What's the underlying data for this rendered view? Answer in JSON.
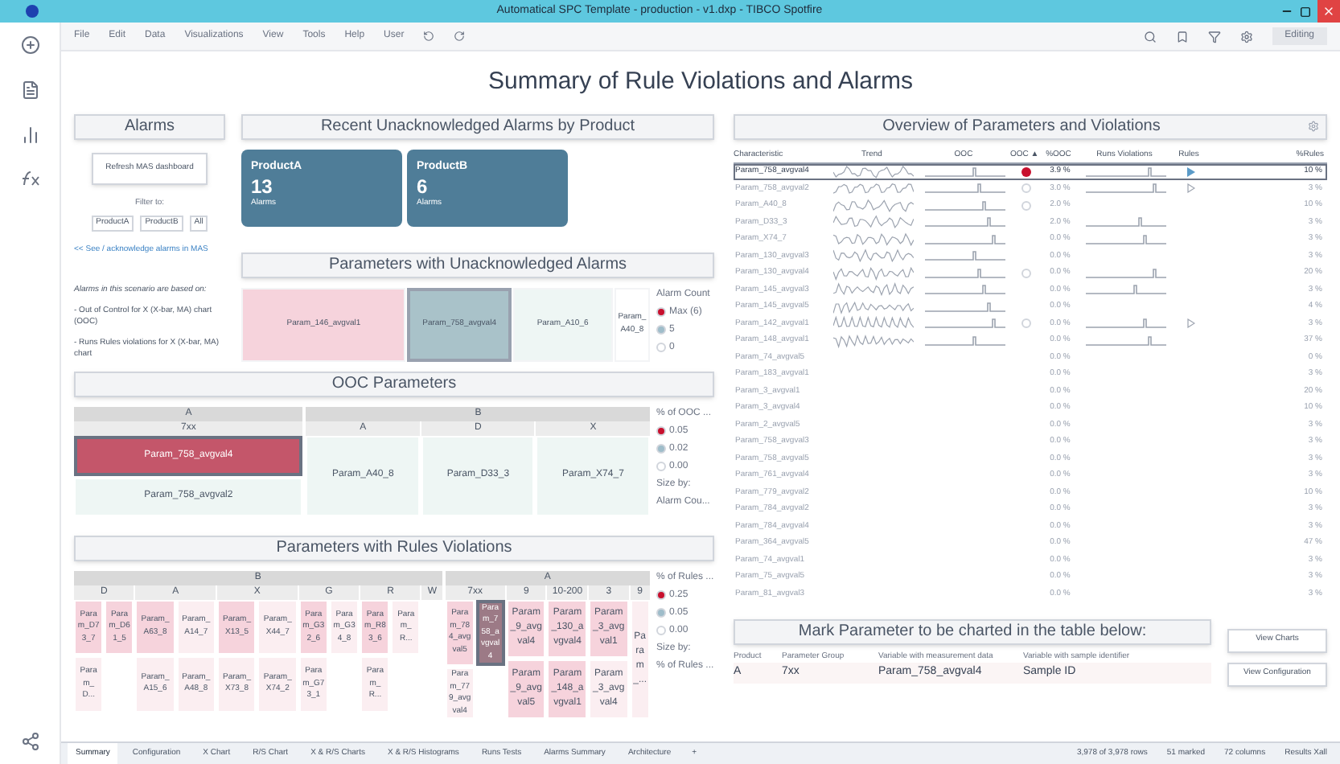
{
  "window": {
    "title": "Automatical SPC Template - production - v1.dxp - TIBCO Spotfire"
  },
  "menu": [
    "File",
    "Edit",
    "Data",
    "Visualizations",
    "View",
    "Tools",
    "Help",
    "User"
  ],
  "mode": "Editing",
  "page_title": "Summary of Rule Violations and Alarms",
  "alarms": {
    "header": "Alarms",
    "refresh": "Refresh MAS dashboard",
    "filter_label": "Filter to:",
    "filters": [
      "ProductA",
      "ProductB",
      "All"
    ],
    "link": "<< See / acknowledge alarms in MAS",
    "notes": [
      "Alarms in this scenario are based on:",
      "- Out of Control for X (X-bar, MA) chart (OOC)",
      "- Runs Rules violations for X (X-bar, MA) chart"
    ]
  },
  "recent": {
    "header": "Recent Unacknowledged Alarms by Product",
    "tiles": [
      {
        "product": "ProductA",
        "count": "13",
        "unit": "Alarms"
      },
      {
        "product": "ProductB",
        "count": "6",
        "unit": "Alarms"
      }
    ]
  },
  "unack": {
    "header": "Parameters with Unacknowledged Alarms",
    "cells": [
      {
        "name": "Param_146_avgval1",
        "color": "#f6d3dc",
        "selected": false
      },
      {
        "name": "Param_758_avgval4",
        "color": "#a9c2c9",
        "selected": true
      },
      {
        "name": "Param_A10_6",
        "color": "#eef6f4",
        "selected": false
      },
      {
        "name": "Param_A40_8",
        "color": "#ffffff",
        "selected": false
      }
    ],
    "legend": {
      "title": "Alarm Count",
      "items": [
        {
          "label": "Max (6)",
          "color": "#c8102e"
        },
        {
          "label": "5",
          "color": "#9fbdca"
        },
        {
          "label": "0",
          "color": "#ffffff"
        }
      ]
    }
  },
  "ooc": {
    "header": "OOC Parameters",
    "groups": [
      {
        "label": "A",
        "subgroups": [
          {
            "label": "7xx",
            "cells": [
              {
                "name": "Param_758_avgval4",
                "color": "#c4566a",
                "selected": true
              },
              {
                "name": "Param_758_avgval2",
                "color": "#eef6f4",
                "selected": false
              }
            ]
          }
        ]
      },
      {
        "label": "B",
        "subgroups": [
          {
            "label": "A",
            "cells": [
              {
                "name": "Param_A40_8",
                "color": "#eef6f4",
                "selected": false
              }
            ]
          },
          {
            "label": "D",
            "cells": [
              {
                "name": "Param_D33_3",
                "color": "#eef6f4",
                "selected": false
              }
            ]
          },
          {
            "label": "X",
            "cells": [
              {
                "name": "Param_X74_7",
                "color": "#eef6f4",
                "selected": false
              }
            ]
          }
        ]
      }
    ],
    "legend": {
      "title": "% of OOC ...",
      "items": [
        {
          "label": "0.05",
          "color": "#c8102e"
        },
        {
          "label": "0.02",
          "color": "#9fbdca"
        },
        {
          "label": "0.00",
          "color": "#ffffff"
        }
      ],
      "size_label": "Size by:",
      "size_value": "Alarm Cou..."
    }
  },
  "rules": {
    "header": "Parameters with Rules Violations",
    "groups": [
      {
        "label": "B",
        "subgroups": [
          {
            "label": "D",
            "cells": [
              {
                "name": "Param_D73_7",
                "color": "#f6d3dc",
                "selected": false
              },
              {
                "name": "Param_D61_5",
                "color": "#f6d3dc",
                "selected": false
              },
              {
                "name": "Param_D...",
                "color": "#fbeef1",
                "selected": false
              }
            ]
          },
          {
            "label": "A",
            "cells": [
              {
                "name": "Param_A63_8",
                "color": "#f6d3dc",
                "selected": false
              },
              {
                "name": "Param_A14_7",
                "color": "#fbeef1",
                "selected": false
              },
              {
                "name": "Param_A15_6",
                "color": "#fbeef1",
                "selected": false
              },
              {
                "name": "Param_A48_8",
                "color": "#fbeef1",
                "selected": false
              }
            ]
          },
          {
            "label": "X",
            "cells": [
              {
                "name": "Param_X13_5",
                "color": "#f6d3dc",
                "selected": false
              },
              {
                "name": "Param_X44_7",
                "color": "#fbeef1",
                "selected": false
              },
              {
                "name": "Param_X73_8",
                "color": "#fbeef1",
                "selected": false
              },
              {
                "name": "Param_X74_2",
                "color": "#fbeef1",
                "selected": false
              }
            ]
          },
          {
            "label": "G",
            "cells": [
              {
                "name": "Param_G32_6",
                "color": "#f6d3dc",
                "selected": false
              },
              {
                "name": "Param_G34_8",
                "color": "#fbeef1",
                "selected": false
              },
              {
                "name": "Param_G73_1",
                "color": "#fbeef1",
                "selected": false
              }
            ]
          },
          {
            "label": "R",
            "cells": [
              {
                "name": "Param_R83_6",
                "color": "#f6d3dc",
                "selected": false
              },
              {
                "name": "Param_R...",
                "color": "#fbeef1",
                "selected": false
              },
              {
                "name": "Param_R...",
                "color": "#fbeef1",
                "selected": false
              }
            ]
          },
          {
            "label": "W"
          }
        ]
      },
      {
        "label": "A",
        "subgroups": [
          {
            "label": "7xx",
            "cells": [
              {
                "name": "Param_784_avgval5",
                "color": "#f6d3dc",
                "selected": false
              },
              {
                "name": "Param_758_avgval4",
                "color": "#9c7a86",
                "selected": true
              },
              {
                "name": "Param_779_avgval4",
                "color": "#fbeef1",
                "selected": false
              }
            ]
          },
          {
            "label": "9",
            "cells": [
              {
                "name": "Param_9_avgval4",
                "color": "#f6d3dc",
                "selected": false
              },
              {
                "name": "Param_9_avgval5",
                "color": "#f6d3dc",
                "selected": false
              }
            ]
          },
          {
            "label": "10-200",
            "cells": [
              {
                "name": "Param_130_avgval4",
                "color": "#f6d3dc",
                "selected": false
              },
              {
                "name": "Param_148_avgval1",
                "color": "#f6d3dc",
                "selected": false
              }
            ]
          },
          {
            "label": "3",
            "cells": [
              {
                "name": "Param_3_avgval1",
                "color": "#f6d3dc",
                "selected": false
              },
              {
                "name": "Param_3_avgval4",
                "color": "#fbeef1",
                "selected": false
              }
            ]
          },
          {
            "label": "9",
            "cells": [
              {
                "name": "Param_...",
                "color": "#fbeef1",
                "selected": false
              }
            ]
          }
        ]
      }
    ],
    "legend": {
      "title": "% of Rules ...",
      "items": [
        {
          "label": "0.25",
          "color": "#c8102e"
        },
        {
          "label": "0.05",
          "color": "#9fbdca"
        },
        {
          "label": "0.00",
          "color": "#ffffff"
        }
      ],
      "size_label": "Size by:",
      "size_value": "% of Rules ..."
    }
  },
  "overview": {
    "header": "Overview of Parameters and Violations",
    "columns": [
      "Characteristic",
      "Trend",
      "OOC",
      "OOC ▲",
      "%OOC",
      "Runs Violations",
      "Rules",
      "%Rules"
    ],
    "rows": [
      {
        "name": "Param_758_avgval4",
        "ooc_pct": "3.9 %",
        "rules_pct": "10 %",
        "ooc_alarm": true,
        "ooc_flag": false,
        "rules_alarm": true,
        "rules_flag": false,
        "trend": true,
        "selected": true
      },
      {
        "name": "Param_758_avgval2",
        "ooc_pct": "3.0 %",
        "rules_pct": "3 %",
        "ooc_alarm": false,
        "ooc_flag": true,
        "rules_alarm": false,
        "rules_flag": true,
        "trend": true,
        "selected": false
      },
      {
        "name": "Param_A40_8",
        "ooc_pct": "2.0 %",
        "rules_pct": "10 %",
        "ooc_alarm": false,
        "ooc_flag": true,
        "rules_alarm": false,
        "rules_flag": false,
        "trend": true,
        "selected": false
      },
      {
        "name": "Param_D33_3",
        "ooc_pct": "2.0 %",
        "rules_pct": "3 %",
        "ooc_alarm": false,
        "ooc_flag": false,
        "rules_alarm": false,
        "rules_flag": false,
        "trend": true,
        "selected": false
      },
      {
        "name": "Param_X74_7",
        "ooc_pct": "0.0 %",
        "rules_pct": "3 %",
        "ooc_alarm": false,
        "ooc_flag": false,
        "rules_alarm": false,
        "rules_flag": false,
        "trend": true,
        "selected": false
      },
      {
        "name": "Param_130_avgval3",
        "ooc_pct": "0.0 %",
        "rules_pct": "3 %",
        "ooc_alarm": false,
        "ooc_flag": false,
        "rules_alarm": false,
        "rules_flag": false,
        "trend": true,
        "selected": false
      },
      {
        "name": "Param_130_avgval4",
        "ooc_pct": "0.0 %",
        "rules_pct": "20 %",
        "ooc_alarm": false,
        "ooc_flag": true,
        "rules_alarm": false,
        "rules_flag": false,
        "trend": true,
        "selected": false
      },
      {
        "name": "Param_145_avgval3",
        "ooc_pct": "0.0 %",
        "rules_pct": "3 %",
        "ooc_alarm": false,
        "ooc_flag": false,
        "rules_alarm": false,
        "rules_flag": false,
        "trend": true,
        "selected": false
      },
      {
        "name": "Param_145_avgval5",
        "ooc_pct": "0.0 %",
        "rules_pct": "4 %",
        "ooc_alarm": false,
        "ooc_flag": false,
        "rules_alarm": false,
        "rules_flag": false,
        "trend": true,
        "selected": false
      },
      {
        "name": "Param_142_avgval1",
        "ooc_pct": "0.0 %",
        "rules_pct": "3 %",
        "ooc_alarm": false,
        "ooc_flag": true,
        "rules_alarm": false,
        "rules_flag": true,
        "trend": true,
        "selected": false
      },
      {
        "name": "Param_148_avgval1",
        "ooc_pct": "0.0 %",
        "rules_pct": "37 %",
        "ooc_alarm": false,
        "ooc_flag": false,
        "rules_alarm": false,
        "rules_flag": false,
        "trend": true,
        "selected": false
      },
      {
        "name": "Param_74_avgval5",
        "ooc_pct": "0.0 %",
        "rules_pct": "0 %",
        "ooc_alarm": false,
        "ooc_flag": false,
        "rules_alarm": false,
        "rules_flag": false,
        "trend": false,
        "selected": false
      },
      {
        "name": "Param_183_avgval1",
        "ooc_pct": "0.0 %",
        "rules_pct": "3 %",
        "ooc_alarm": false,
        "ooc_flag": false,
        "rules_alarm": false,
        "rules_flag": false,
        "trend": false,
        "selected": false
      },
      {
        "name": "Param_3_avgval1",
        "ooc_pct": "0.0 %",
        "rules_pct": "20 %",
        "ooc_alarm": false,
        "ooc_flag": false,
        "rules_alarm": false,
        "rules_flag": false,
        "trend": false,
        "selected": false
      },
      {
        "name": "Param_3_avgval4",
        "ooc_pct": "0.0 %",
        "rules_pct": "10 %",
        "ooc_alarm": false,
        "ooc_flag": false,
        "rules_alarm": false,
        "rules_flag": false,
        "trend": false,
        "selected": false
      },
      {
        "name": "Param_2_avgval5",
        "ooc_pct": "0.0 %",
        "rules_pct": "3 %",
        "ooc_alarm": false,
        "ooc_flag": false,
        "rules_alarm": false,
        "rules_flag": false,
        "trend": false,
        "selected": false
      },
      {
        "name": "Param_758_avgval3",
        "ooc_pct": "0.0 %",
        "rules_pct": "3 %",
        "ooc_alarm": false,
        "ooc_flag": false,
        "rules_alarm": false,
        "rules_flag": false,
        "trend": false,
        "selected": false
      },
      {
        "name": "Param_758_avgval5",
        "ooc_pct": "0.0 %",
        "rules_pct": "3 %",
        "ooc_alarm": false,
        "ooc_flag": false,
        "rules_alarm": false,
        "rules_flag": false,
        "trend": false,
        "selected": false
      },
      {
        "name": "Param_761_avgval4",
        "ooc_pct": "0.0 %",
        "rules_pct": "3 %",
        "ooc_alarm": false,
        "ooc_flag": false,
        "rules_alarm": false,
        "rules_flag": false,
        "trend": false,
        "selected": false
      },
      {
        "name": "Param_779_avgval2",
        "ooc_pct": "0.0 %",
        "rules_pct": "10 %",
        "ooc_alarm": false,
        "ooc_flag": false,
        "rules_alarm": false,
        "rules_flag": false,
        "trend": false,
        "selected": false
      },
      {
        "name": "Param_784_avgval2",
        "ooc_pct": "0.0 %",
        "rules_pct": "3 %",
        "ooc_alarm": false,
        "ooc_flag": false,
        "rules_alarm": false,
        "rules_flag": false,
        "trend": false,
        "selected": false
      },
      {
        "name": "Param_784_avgval4",
        "ooc_pct": "0.0 %",
        "rules_pct": "3 %",
        "ooc_alarm": false,
        "ooc_flag": false,
        "rules_alarm": false,
        "rules_flag": false,
        "trend": false,
        "selected": false
      },
      {
        "name": "Param_364_avgval5",
        "ooc_pct": "0.0 %",
        "rules_pct": "47 %",
        "ooc_alarm": false,
        "ooc_flag": false,
        "rules_alarm": false,
        "rules_flag": false,
        "trend": false,
        "selected": false
      },
      {
        "name": "Param_74_avgval1",
        "ooc_pct": "0.0 %",
        "rules_pct": "3 %",
        "ooc_alarm": false,
        "ooc_flag": false,
        "rules_alarm": false,
        "rules_flag": false,
        "trend": false,
        "selected": false
      },
      {
        "name": "Param_75_avgval5",
        "ooc_pct": "0.0 %",
        "rules_pct": "3 %",
        "ooc_alarm": false,
        "ooc_flag": false,
        "rules_alarm": false,
        "rules_flag": false,
        "trend": false,
        "selected": false
      },
      {
        "name": "Param_81_avgval3",
        "ooc_pct": "0.0 %",
        "rules_pct": "3 %",
        "ooc_alarm": false,
        "ooc_flag": false,
        "rules_alarm": false,
        "rules_flag": false,
        "trend": false,
        "selected": false
      }
    ]
  },
  "mark": {
    "header": "Mark Parameter to be charted in the table below:",
    "columns": [
      "Product",
      "Parameter Group",
      "Variable with measurement data",
      "Variable with sample identifier"
    ],
    "row": [
      "A",
      "7xx",
      "Param_758_avgval4",
      "Sample ID"
    ]
  },
  "buttons": [
    "View Charts",
    "View Configuration"
  ],
  "tabs": [
    {
      "label": "Summary",
      "selected": true
    },
    {
      "label": "Configuration",
      "selected": false
    },
    {
      "label": "X Chart",
      "selected": false
    },
    {
      "label": "R/S Chart",
      "selected": false
    },
    {
      "label": "X & R/S Charts",
      "selected": false
    },
    {
      "label": "X & R/S Histograms",
      "selected": false
    },
    {
      "label": "Runs Tests",
      "selected": false
    },
    {
      "label": "Alarms Summary",
      "selected": false
    },
    {
      "label": "Architecture",
      "selected": false
    }
  ],
  "add_tab": "+",
  "status": [
    "3,978 of 3,978 rows",
    "51 marked",
    "72 columns",
    "Results Xall"
  ]
}
